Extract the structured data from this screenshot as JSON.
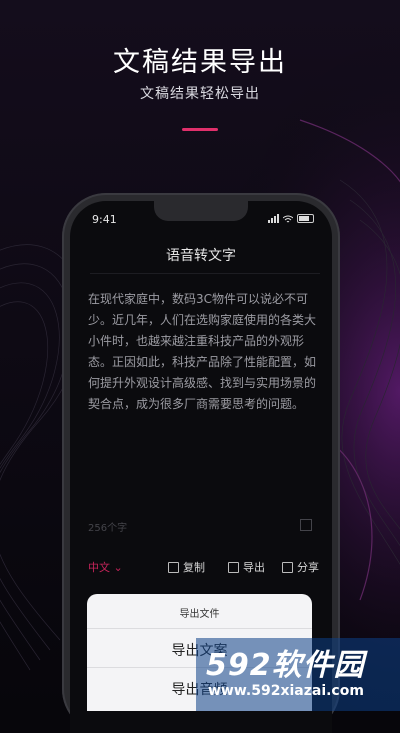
{
  "hero": {
    "title": "文稿结果导出",
    "subtitle": "文稿结果轻松导出"
  },
  "status_bar": {
    "time": "9:41"
  },
  "app": {
    "title": "语音转文字",
    "transcript": "在现代家庭中，数码3C物件可以说必不可少。近几年，人们在选购家庭使用的各类大小件时，也越来越注重科技产品的外观形态。正因如此，科技产品除了性能配置，如何提升外观设计高级感、找到与实用场景的契合点，成为很多厂商需要思考的问题。",
    "char_count": "256个字"
  },
  "toolbar": {
    "language": "中文",
    "copy_label": "复制",
    "export_label": "导出",
    "share_label": "分享"
  },
  "export_sheet": {
    "title": "导出文件",
    "option_text": "导出文案",
    "option_audio": "导出音频"
  },
  "watermark": {
    "brand": "592软件园",
    "url": "www.592xiazai.com"
  },
  "colors": {
    "accent": "#e0306b",
    "background": "#07060b"
  }
}
